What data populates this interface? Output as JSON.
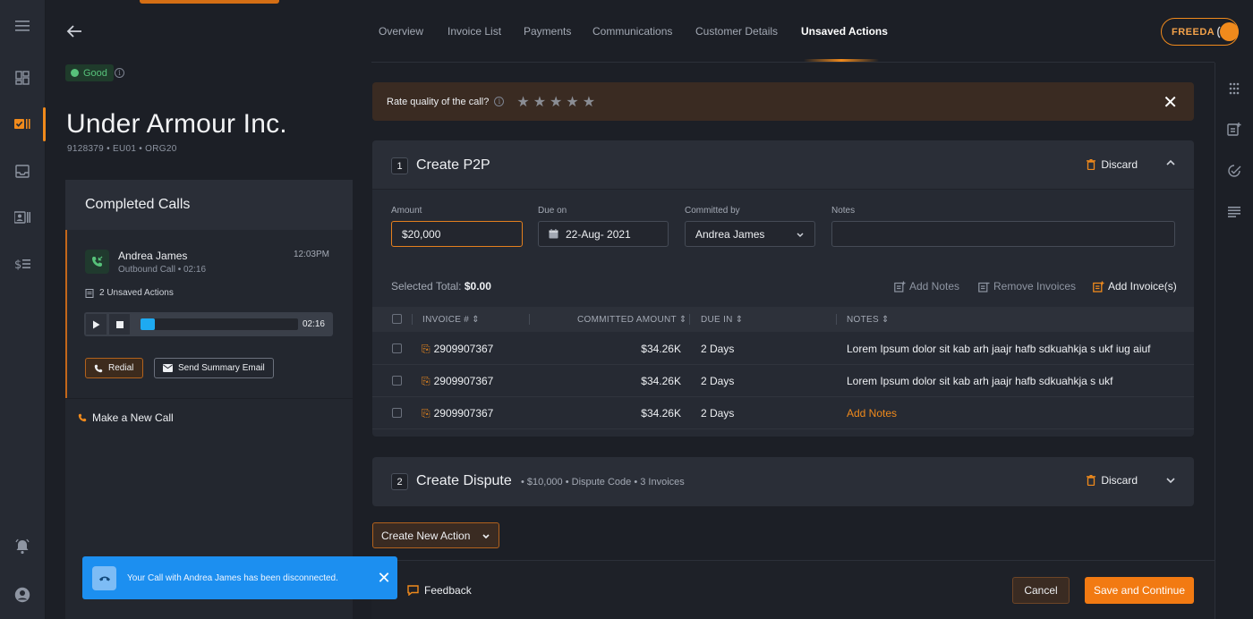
{
  "header": {
    "tabs": [
      {
        "label": "Overview"
      },
      {
        "label": "Invoice List"
      },
      {
        "label": "Payments"
      },
      {
        "label": "Communications"
      },
      {
        "label": "Customer Details"
      },
      {
        "label": "Unsaved Actions"
      }
    ],
    "active_tab": "Unsaved Actions",
    "assistant_label": "FREEDA"
  },
  "customer": {
    "status": "Good",
    "name": "Under Armour Inc.",
    "meta": "9128379  •  EU01  •  ORG20"
  },
  "calls": {
    "title": "Completed Calls",
    "entry": {
      "name": "Andrea James",
      "subtitle": "Outbound Call  •  02:16",
      "time": "12:03PM",
      "unsaved": "2 Unsaved Actions",
      "duration": "02:16",
      "progress": 0.09
    },
    "redial_label": "Redial",
    "summary_label": "Send Summary Email",
    "new_call_label": "Make a New Call"
  },
  "toast": {
    "text": "Your Call with Andrea James has been disconnected."
  },
  "rating": {
    "label": "Rate quality of the call?",
    "stars": 5,
    "value": 0
  },
  "p2p": {
    "index": "1",
    "title": "Create P2P",
    "discard_label": "Discard",
    "fields": {
      "amount_label": "Amount",
      "amount_value": "$20,000",
      "due_label": "Due on",
      "due_value": "22-Aug- 2021",
      "committed_label": "Committed by",
      "committed_value": "Andrea James",
      "notes_label": "Notes",
      "notes_value": ""
    },
    "selected_total_label": "Selected Total:",
    "selected_total_value": "$0.00",
    "actions": {
      "add_notes": "Add Notes",
      "remove_invoices": "Remove Invoices",
      "add_invoices": "Add Invoice(s)"
    },
    "columns": [
      "INVOICE #",
      "COMMITTED AMOUNT",
      "DUE IN",
      "NOTES"
    ],
    "rows": [
      {
        "invoice": "2909907367",
        "amount": "$34.26K",
        "due": "2 Days",
        "notes": "Lorem Ipsum dolor sit kab arh jaajr hafb sdkuahkja s ukf iug aiuf"
      },
      {
        "invoice": "2909907367",
        "amount": "$34.26K",
        "due": "2 Days",
        "notes": "Lorem Ipsum dolor sit kab arh jaajr hafb sdkuahkja s ukf"
      },
      {
        "invoice": "2909907367",
        "amount": "$34.26K",
        "due": "2 Days",
        "notes": "Add Notes"
      }
    ]
  },
  "dispute": {
    "index": "2",
    "title": "Create Dispute",
    "meta": "•  $10,000   •  Dispute Code   •  3 Invoices",
    "discard_label": "Discard"
  },
  "new_action_label": "Create New Action",
  "footer": {
    "feedback_label": "Feedback",
    "cancel_label": "Cancel",
    "save_label": "Save and Continue"
  },
  "colors": {
    "accent": "#f08a1c",
    "good": "#57c27a",
    "progress": "#1eaaf1",
    "toast": "#1c8ff0"
  }
}
